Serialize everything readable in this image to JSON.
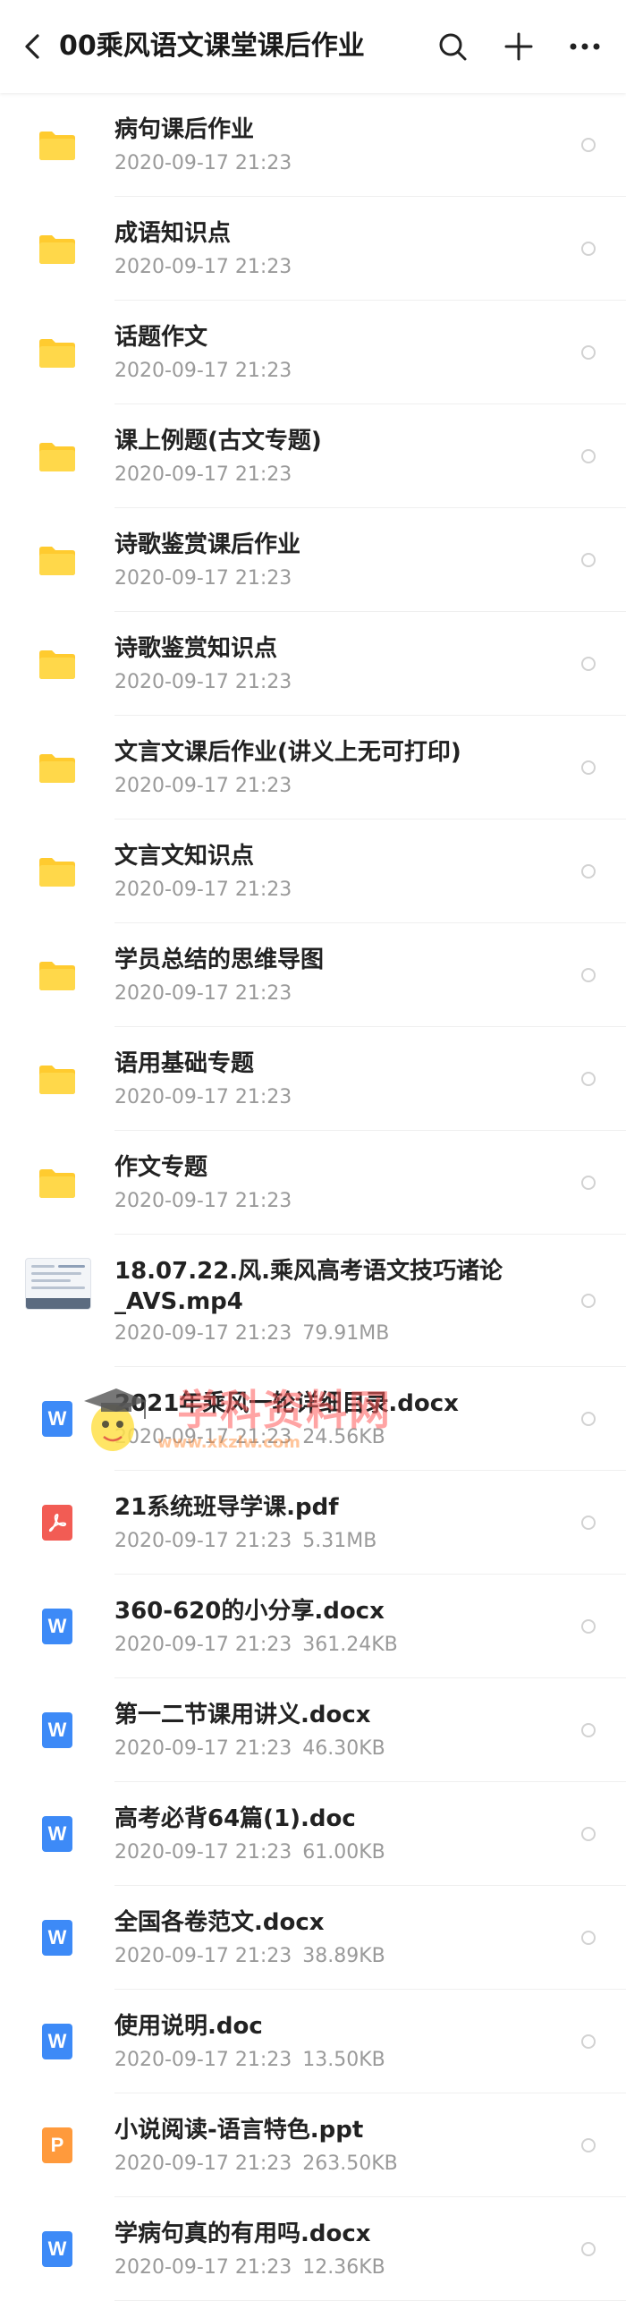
{
  "header": {
    "title": "00乘风语文课堂课后作业"
  },
  "files": [
    {
      "name": "病句课后作业",
      "date": "2020-09-17  21:23",
      "size": "",
      "type": "folder"
    },
    {
      "name": "成语知识点",
      "date": "2020-09-17  21:23",
      "size": "",
      "type": "folder"
    },
    {
      "name": "话题作文",
      "date": "2020-09-17  21:23",
      "size": "",
      "type": "folder"
    },
    {
      "name": "课上例题(古文专题)",
      "date": "2020-09-17  21:23",
      "size": "",
      "type": "folder"
    },
    {
      "name": "诗歌鉴赏课后作业",
      "date": "2020-09-17  21:23",
      "size": "",
      "type": "folder"
    },
    {
      "name": "诗歌鉴赏知识点",
      "date": "2020-09-17  21:23",
      "size": "",
      "type": "folder"
    },
    {
      "name": "文言文课后作业(讲义上无可打印)",
      "date": "2020-09-17  21:23",
      "size": "",
      "type": "folder"
    },
    {
      "name": "文言文知识点",
      "date": "2020-09-17  21:23",
      "size": "",
      "type": "folder"
    },
    {
      "name": "学员总结的思维导图",
      "date": "2020-09-17  21:23",
      "size": "",
      "type": "folder"
    },
    {
      "name": "语用基础专题",
      "date": "2020-09-17  21:23",
      "size": "",
      "type": "folder"
    },
    {
      "name": "作文专题",
      "date": "2020-09-17  21:23",
      "size": "",
      "type": "folder"
    },
    {
      "name": "18.07.22.风.乘风高考语文技巧诸论_AVS.mp4",
      "date": "2020-09-17  21:23",
      "size": "79.91MB",
      "type": "video"
    },
    {
      "name": "2021年乘风一轮详细目录.docx",
      "date": "2020-09-17  21:23",
      "size": "24.56KB",
      "type": "word"
    },
    {
      "name": "21系统班导学课.pdf",
      "date": "2020-09-17  21:23",
      "size": "5.31MB",
      "type": "pdf"
    },
    {
      "name": "360-620的小分享.docx",
      "date": "2020-09-17  21:23",
      "size": "361.24KB",
      "type": "word"
    },
    {
      "name": "第一二节课用讲义.docx",
      "date": "2020-09-17  21:23",
      "size": "46.30KB",
      "type": "word"
    },
    {
      "name": "高考必背64篇(1).doc",
      "date": "2020-09-17  21:23",
      "size": "61.00KB",
      "type": "word"
    },
    {
      "name": "全国各卷范文.docx",
      "date": "2020-09-17  21:23",
      "size": "38.89KB",
      "type": "word"
    },
    {
      "name": "使用说明.doc",
      "date": "2020-09-17  21:23",
      "size": "13.50KB",
      "type": "word"
    },
    {
      "name": "小说阅读-语言特色.ppt",
      "date": "2020-09-17  21:23",
      "size": "263.50KB",
      "type": "ppt"
    },
    {
      "name": "学病句真的有用吗.docx",
      "date": "2020-09-17  21:23",
      "size": "12.36KB",
      "type": "word"
    }
  ],
  "watermark": {
    "text": "学科资料网",
    "url": "www.xkzlw.com"
  },
  "colors": {
    "folder": "#FFCB2F",
    "word": "#3D8AF7",
    "pdf": "#F25C54",
    "ppt": "#FF9A3C"
  }
}
